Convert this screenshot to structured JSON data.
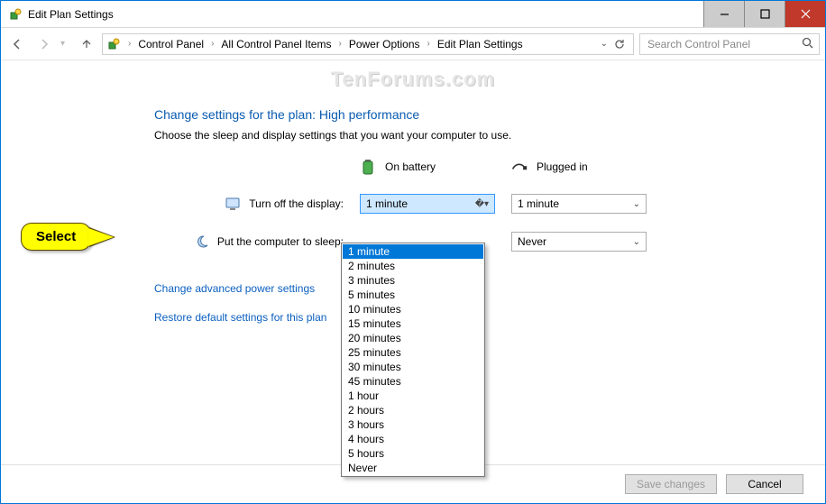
{
  "window": {
    "title": "Edit Plan Settings"
  },
  "breadcrumb": {
    "items": [
      "Control Panel",
      "All Control Panel Items",
      "Power Options",
      "Edit Plan Settings"
    ]
  },
  "search": {
    "placeholder": "Search Control Panel"
  },
  "watermark": "TenForums.com",
  "page": {
    "title": "Change settings for the plan: High performance",
    "description": "Choose the sleep and display settings that you want your computer to use."
  },
  "columns": {
    "battery": "On battery",
    "plugged": "Plugged in"
  },
  "rows": {
    "display": {
      "label": "Turn off the display:",
      "battery_value": "1 minute",
      "plugged_value": "1 minute"
    },
    "sleep": {
      "label": "Put the computer to sleep:",
      "battery_value": "",
      "plugged_value": "Never"
    }
  },
  "dropdown": {
    "options": [
      "1 minute",
      "2 minutes",
      "3 minutes",
      "5 minutes",
      "10 minutes",
      "15 minutes",
      "20 minutes",
      "25 minutes",
      "30 minutes",
      "45 minutes",
      "1 hour",
      "2 hours",
      "3 hours",
      "4 hours",
      "5 hours",
      "Never"
    ],
    "selected_index": 0
  },
  "links": {
    "advanced": "Change advanced power settings",
    "restore": "Restore default settings for this plan"
  },
  "buttons": {
    "save": "Save changes",
    "cancel": "Cancel"
  },
  "callout": {
    "text": "Select"
  }
}
